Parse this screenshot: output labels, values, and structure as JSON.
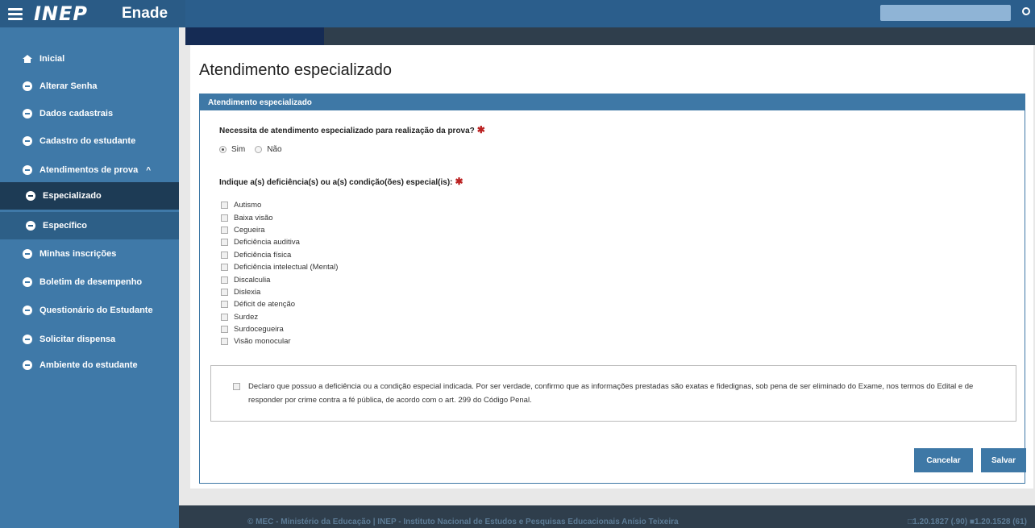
{
  "header": {
    "logo": "INEP",
    "app_name": "Enade"
  },
  "sidebar": {
    "items": [
      {
        "label": "Inicial"
      },
      {
        "label": "Alterar Senha"
      },
      {
        "label": "Dados cadastrais"
      },
      {
        "label": "Cadastro do estudante"
      },
      {
        "label": "Atendimentos de prova",
        "caret": "^"
      },
      {
        "label": "Especializado"
      },
      {
        "label": "Específico"
      },
      {
        "label": "Minhas inscrições"
      },
      {
        "label": "Boletim de desempenho"
      },
      {
        "label": "Questionário do Estudante"
      },
      {
        "label": "Solicitar dispensa"
      },
      {
        "label": "Ambiente do estudante"
      }
    ]
  },
  "main": {
    "title": "Atendimento especializado",
    "panel_title": "Atendimento especializado",
    "question1": "Necessita de atendimento especializado para realização da prova?",
    "required_mark": "✱",
    "radio_yes": "Sim",
    "radio_no": "Não",
    "question2": "Indique a(s) deficiência(s) ou a(s) condição(ões) especial(is):",
    "conditions": [
      "Autismo",
      "Baixa visão",
      "Cegueira",
      "Deficiência auditiva",
      "Deficiência física",
      "Deficiência intelectual (Mental)",
      "Discalculia",
      "Dislexia",
      "Déficit de atenção",
      "Surdez",
      "Surdocegueira",
      "Visão monocular"
    ],
    "declaration": "Declaro que possuo a deficiência ou a condição especial indicada. Por ser verdade, confirmo que as informações prestadas são exatas e fidedignas, sob pena de ser eliminado do Exame, nos termos do Edital e de responder por crime contra a fé pública, de acordo com o art. 299 do Código Penal.",
    "cancel_label": "Cancelar",
    "save_label": "Salvar"
  },
  "footer": {
    "text": "© MEC - Ministério da Educação | INEP - Instituto Nacional de Estudos e Pesquisas Educacionais Anísio Teixeira",
    "right_text": "□1.20.1827 (.90) ■1.20.1528 (61)"
  }
}
